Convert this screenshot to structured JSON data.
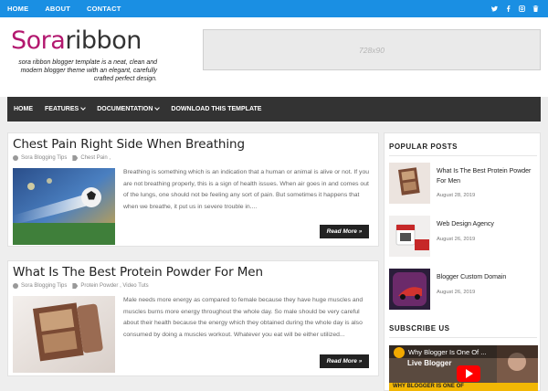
{
  "topnav": {
    "items": [
      "HOME",
      "ABOUT",
      "CONTACT"
    ]
  },
  "social": {
    "icons": [
      "twitter-icon",
      "facebook-icon",
      "instagram-icon",
      "trash-icon"
    ]
  },
  "header": {
    "logo_part1": "Sora",
    "logo_part2": "ribbon",
    "tagline": "sora ribbon blogger template is a neat, clean and modern blogger theme with an elegant, carefully crafted perfect design.",
    "ad_label": "728x90"
  },
  "mainnav": {
    "home": "HOME",
    "features": "FEATURES",
    "documentation": "DOCUMENTATION",
    "download": "DOWNLOAD THIS TEMPLATE"
  },
  "posts": [
    {
      "title": "Chest Pain Right Side When Breathing",
      "author": "Sora Blogging Tips",
      "labels": "Chest Pain ,",
      "excerpt": "Breathing is something which is an indication that a human or animal is alive or not. If you are not breathing properly, this is a sign of health issues. When air goes in and comes out of the lungs, one should not be feeling any sort of pain. But sometimes it happens that when we breathe, it put us in severe trouble in....",
      "read_more": "Read More »"
    },
    {
      "title": "What Is The Best Protein Powder For Men",
      "author": "Sora Blogging Tips",
      "labels": "Protein Powder , Video Tuts",
      "excerpt": "Male needs more energy as compared to female because they have huge muscles and muscles burns more energy throughout the whole day. So male should be very careful about their health because the energy which they obtained during the whole day is also consumed by doing a muscles workout. Whatever you eat will be either utilized...",
      "read_more": "Read More »"
    }
  ],
  "sidebar": {
    "popular_title": "POPULAR POSTS",
    "popular": [
      {
        "title": "What Is The Best Protein Powder For Men",
        "date": "August 28, 2019"
      },
      {
        "title": "Web Design Agency",
        "date": "August 26, 2019"
      },
      {
        "title": "Blogger Custom Domain",
        "date": "August 26, 2019"
      }
    ],
    "subscribe_title": "SUBSCRIBE US",
    "video_title": "Why Blogger Is One Of ...",
    "video_caption": "Live Blogger",
    "video_bottom": "WHY BLOGGER IS ONE OF"
  },
  "colors": {
    "topbar": "#1a8fe3",
    "nav": "#333333",
    "brand": "#b3186f",
    "button": "#222222"
  }
}
